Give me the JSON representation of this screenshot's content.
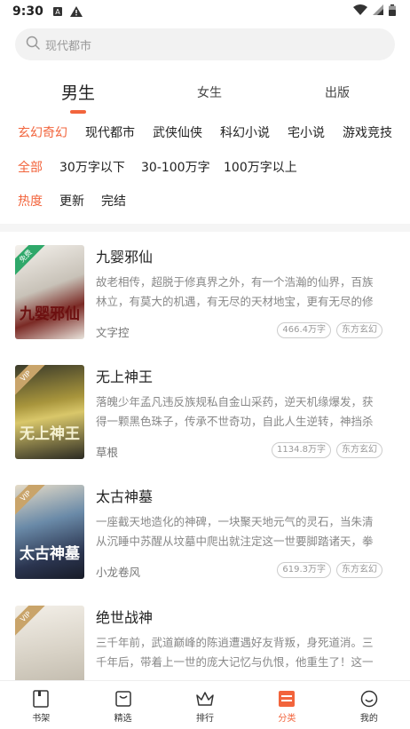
{
  "status_bar": {
    "time": "9:30"
  },
  "search": {
    "placeholder": "现代都市"
  },
  "gender_tabs": [
    {
      "label": "男生",
      "active": true
    },
    {
      "label": "女生",
      "active": false
    },
    {
      "label": "出版",
      "active": false
    }
  ],
  "category_filters": [
    "玄幻奇幻",
    "现代都市",
    "武侠仙侠",
    "科幻小说",
    "宅小说",
    "游戏竞技"
  ],
  "word_count_filters": [
    "全部",
    "30万字以下",
    "30-100万字",
    "100万字以上"
  ],
  "sort_filters": [
    "热度",
    "更新",
    "完结"
  ],
  "books": [
    {
      "title": "九婴邪仙",
      "description": "故老相传，超脱于修真界之外，有一个浩瀚的仙界，百族林立，有莫大的机遇，有无尽的天材地宝，更有无尽的修炼...",
      "author": "文字控",
      "word_count": "466.4万字",
      "genre": "东方玄幻",
      "badge": "免费",
      "cover_text": "九婴邪仙"
    },
    {
      "title": "无上神王",
      "description": "落魄少年孟凡违反族规私自金山采药，逆天机缘爆发，获得一颗黑色珠子，传承不世奇功，自此人生逆转，神挡杀神...",
      "author": "草根",
      "word_count": "1134.8万字",
      "genre": "东方玄幻",
      "badge": "VIP",
      "cover_text": "无上神王"
    },
    {
      "title": "太古神墓",
      "description": "一座截天地造化的神碑，一块聚天地元气的灵石，当朱清从沉睡中苏醒从坟墓中爬出就注定这一世要脚踏诸天，拳破...",
      "author": "小龙卷风",
      "word_count": "619.3万字",
      "genre": "东方玄幻",
      "badge": "VIP",
      "cover_text": "太古神墓"
    },
    {
      "title": "绝世战神",
      "description": "三千年前，武道巅峰的陈逍遭遇好友背叛，身死道消。三千年后，带着上一世的庞大记忆与仇恨，他重生了！这一世...",
      "author": "",
      "word_count": "",
      "genre": "",
      "badge": "VIP",
      "cover_text": ""
    }
  ],
  "bottom_nav": [
    {
      "label": "书架",
      "icon": "bookshelf-icon",
      "active": false
    },
    {
      "label": "精选",
      "icon": "featured-icon",
      "active": false
    },
    {
      "label": "排行",
      "icon": "crown-icon",
      "active": false
    },
    {
      "label": "分类",
      "icon": "category-icon",
      "active": true
    },
    {
      "label": "我的",
      "icon": "profile-icon",
      "active": false
    }
  ],
  "colors": {
    "accent": "#f2643c",
    "free_badge": "#2fa86a",
    "vip_badge": "#c9a46a"
  }
}
